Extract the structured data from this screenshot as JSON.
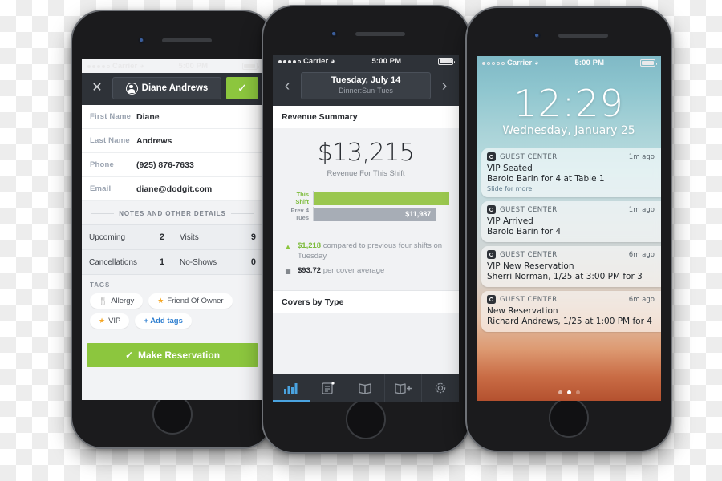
{
  "phone1": {
    "name": "guest-profile-phone",
    "statusbar": {
      "carrier": "Carrier",
      "time": "5:00 PM"
    },
    "nav": {
      "close_label": "✕",
      "guest_name": "Diane Andrews",
      "confirm_label": "✓"
    },
    "fields": [
      {
        "label": "First Name",
        "value": "Diane"
      },
      {
        "label": "Last Name",
        "value": "Andrews"
      },
      {
        "label": "Phone",
        "value": "(925) 876-7633"
      },
      {
        "label": "Email",
        "value": "diane@dodgit.com"
      }
    ],
    "section_divider": "NOTES AND OTHER DETAILS",
    "stats": [
      {
        "key": "Upcoming",
        "value": "2"
      },
      {
        "key": "Visits",
        "value": "9"
      },
      {
        "key": "Cancellations",
        "value": "1"
      },
      {
        "key": "No-Shows",
        "value": "0"
      }
    ],
    "tags_header": "TAGS",
    "tags": [
      {
        "label": "Allergy",
        "icon": "fork-knife-icon",
        "glyph": "🍴"
      },
      {
        "label": "Friend Of Owner",
        "icon": "star-icon",
        "glyph": "★"
      },
      {
        "label": "VIP",
        "icon": "star-icon",
        "glyph": "★"
      },
      {
        "label": "+ Add tags",
        "icon": "add-icon",
        "glyph": ""
      }
    ],
    "cta": {
      "label": "Make Reservation",
      "check": "✓",
      "color": "#8cc63e"
    }
  },
  "phone2": {
    "name": "revenue-summary-phone",
    "statusbar": {
      "carrier": "Carrier",
      "time": "5:00 PM"
    },
    "nav": {
      "prev": "‹",
      "next": "›",
      "date": "Tuesday, July 14",
      "shift": "Dinner:Sun-Tues"
    },
    "card_title": "Revenue Summary",
    "revenue_value": "$13,215",
    "revenue_caption": "Revenue For This Shift",
    "notes": [
      {
        "icon": "triangle-up-icon",
        "amount": "$1,218",
        "text": " compared to previous four shifts on Tuesday"
      },
      {
        "icon": "receipt-icon",
        "amount": "$93.72",
        "text": " per cover average"
      }
    ],
    "section2_title": "Covers by Type",
    "tabs": [
      {
        "name": "tab-analytics",
        "icon": "bar-chart-icon",
        "active": true
      },
      {
        "name": "tab-reservations",
        "icon": "clipboard-icon",
        "active": false
      },
      {
        "name": "tab-book",
        "icon": "book-icon",
        "active": false
      },
      {
        "name": "tab-add-booking",
        "icon": "book-plus-icon",
        "active": false
      },
      {
        "name": "tab-settings",
        "icon": "gear-icon",
        "active": false
      }
    ],
    "chart_data": {
      "type": "bar",
      "title": "Revenue Summary",
      "orientation": "horizontal",
      "categories": [
        "This Shift",
        "Prev 4 Tues"
      ],
      "values": [
        13215,
        11987
      ],
      "value_labels": [
        "",
        "$11,987"
      ],
      "colors": [
        "#9ac74f",
        "#a7adb6"
      ],
      "xlabel": "",
      "ylabel": "",
      "xlim": [
        0,
        13215
      ],
      "grid": false,
      "legend": "none"
    }
  },
  "phone3": {
    "name": "lock-screen-phone",
    "statusbar": {
      "carrier": "Carrier",
      "time": "5:00 PM"
    },
    "clock": "12:29",
    "date": "Wednesday, January 25",
    "notifications": [
      {
        "app": "GUEST CENTER",
        "time": "1m ago",
        "line1": "VIP Seated",
        "line2": "Barolo Barin for 4 at Table 1",
        "slide": "Slide for more"
      },
      {
        "app": "GUEST CENTER",
        "time": "1m ago",
        "line1": "VIP Arrived",
        "line2": "Barolo Barin for 4",
        "slide": ""
      },
      {
        "app": "GUEST CENTER",
        "time": "6m ago",
        "line1": "VIP New Reservation",
        "line2": "Sherri Norman, 1/25 at 3:00 PM for 3",
        "slide": ""
      },
      {
        "app": "GUEST CENTER",
        "time": "6m ago",
        "line1": "New Reservation",
        "line2": "Richard Andrews, 1/25 at 1:00 PM for 4",
        "slide": ""
      }
    ]
  }
}
